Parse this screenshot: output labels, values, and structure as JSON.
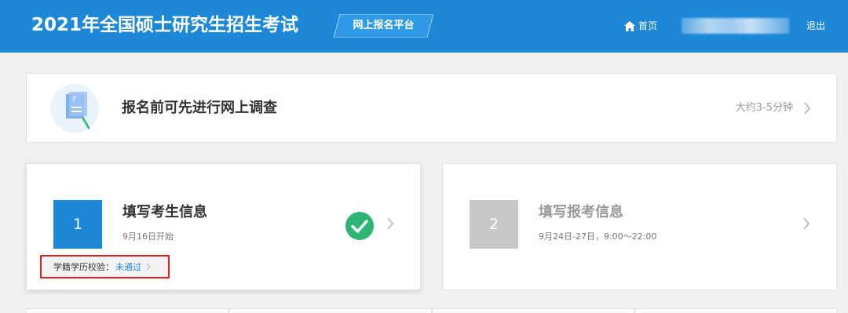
{
  "header": {
    "title": "2021年全国硕士研究生招生考试",
    "platform_badge": "网上报名平台",
    "home_label": "首页",
    "logout_label": "退出",
    "background_color": "#1d88d8"
  },
  "survey": {
    "title": "报名前可先进行网上调查",
    "time": "大约3-5分钟",
    "icon": "survey-document-icon"
  },
  "steps": [
    {
      "number": "1",
      "title": "填写考生信息",
      "subtitle": "9月16日开始",
      "status": "completed",
      "accent_color": "#1d88d8",
      "verify_label": "学籍学历校验：",
      "verify_status": "未通过"
    },
    {
      "number": "2",
      "title": "填写报考信息",
      "subtitle": "9月24日-27日，9:00～22:00",
      "status": "inactive",
      "accent_color": "#c8c8c8"
    }
  ]
}
